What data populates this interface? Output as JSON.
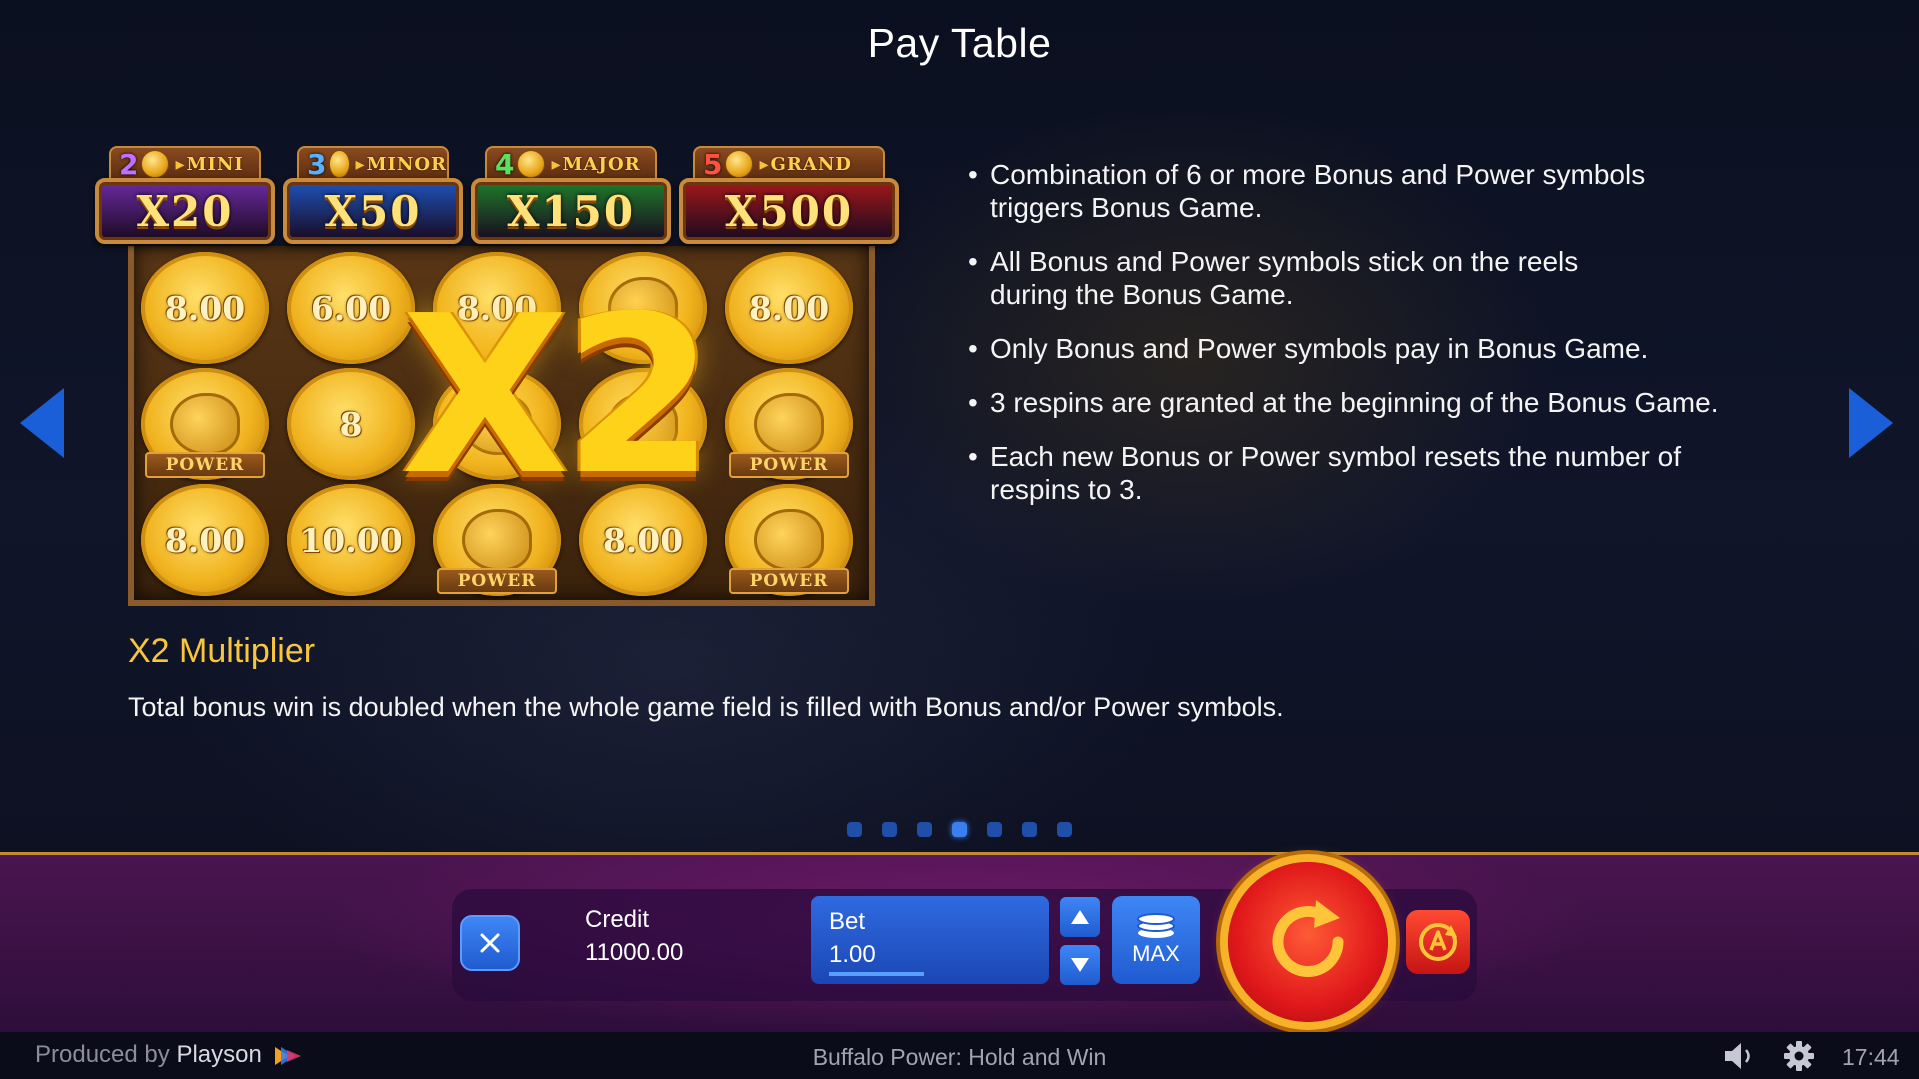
{
  "page_title": "Pay Table",
  "jackpots": [
    {
      "count": "2",
      "name": "MINI",
      "value": "X20",
      "count_color": "#c070ff",
      "bg": "#6a2aa0"
    },
    {
      "count": "3",
      "name": "MINOR",
      "value": "X50",
      "count_color": "#5ab0ff",
      "bg": "#1c52b8"
    },
    {
      "count": "4",
      "name": "MAJOR",
      "value": "X150",
      "count_color": "#5ae05a",
      "bg": "#1e7a2a"
    },
    {
      "count": "5",
      "name": "GRAND",
      "value": "X500",
      "count_color": "#ff5040",
      "bg": "#a01818"
    }
  ],
  "reel_coins": [
    {
      "value": "8.00",
      "power": false
    },
    {
      "value": "6.00",
      "power": false
    },
    {
      "value": "8.00",
      "power": false
    },
    {
      "value": "",
      "power": false
    },
    {
      "value": "8.00",
      "power": false
    },
    {
      "value": "",
      "power": true,
      "label": "POWER"
    },
    {
      "value": "8",
      "power": false
    },
    {
      "value": "",
      "power": false
    },
    {
      "value": "",
      "power": false
    },
    {
      "value": "",
      "power": true,
      "label": "POWER"
    },
    {
      "value": "8.00",
      "power": false
    },
    {
      "value": "10.00",
      "power": false
    },
    {
      "value": "",
      "power": true,
      "label": "POWER"
    },
    {
      "value": "8.00",
      "power": false
    },
    {
      "value": "",
      "power": true,
      "label": "POWER"
    }
  ],
  "multiplier_art": "X2",
  "rules": [
    "Combination of 6 or more Bonus and Power symbols triggers Bonus Game.",
    "All Bonus and Power symbols stick on the reels during the Bonus Game.",
    "Only Bonus and Power symbols pay in Bonus Game.",
    "3 respins are granted at the beginning of the Bonus Game.",
    "Each new Bonus or Power symbol resets the number of respins to 3."
  ],
  "feature": {
    "title": "X2 Multiplier",
    "description": "Total bonus win is doubled when the whole game field is filled with Bonus and/or Power symbols."
  },
  "pagination": {
    "total": 7,
    "current": 4
  },
  "controls": {
    "close_icon": "close-icon",
    "credit_label": "Credit",
    "credit_value": "11000.00",
    "bet_label": "Bet",
    "bet_value": "1.00",
    "bet_up_icon": "arrow-up-icon",
    "bet_down_icon": "arrow-down-icon",
    "max_label": "MAX",
    "spin_icon": "spin-icon",
    "autoplay_icon": "autoplay-icon"
  },
  "footer": {
    "produced_by": "Produced by",
    "brand": "Playson",
    "game_name": "Buffalo Power: Hold and Win",
    "time": "17:44"
  },
  "colors": {
    "accent_gold": "#f8c63c",
    "button_blue": "#2f6ae0",
    "spin_red": "#e0181a",
    "bar_purple": "#4a1550"
  }
}
